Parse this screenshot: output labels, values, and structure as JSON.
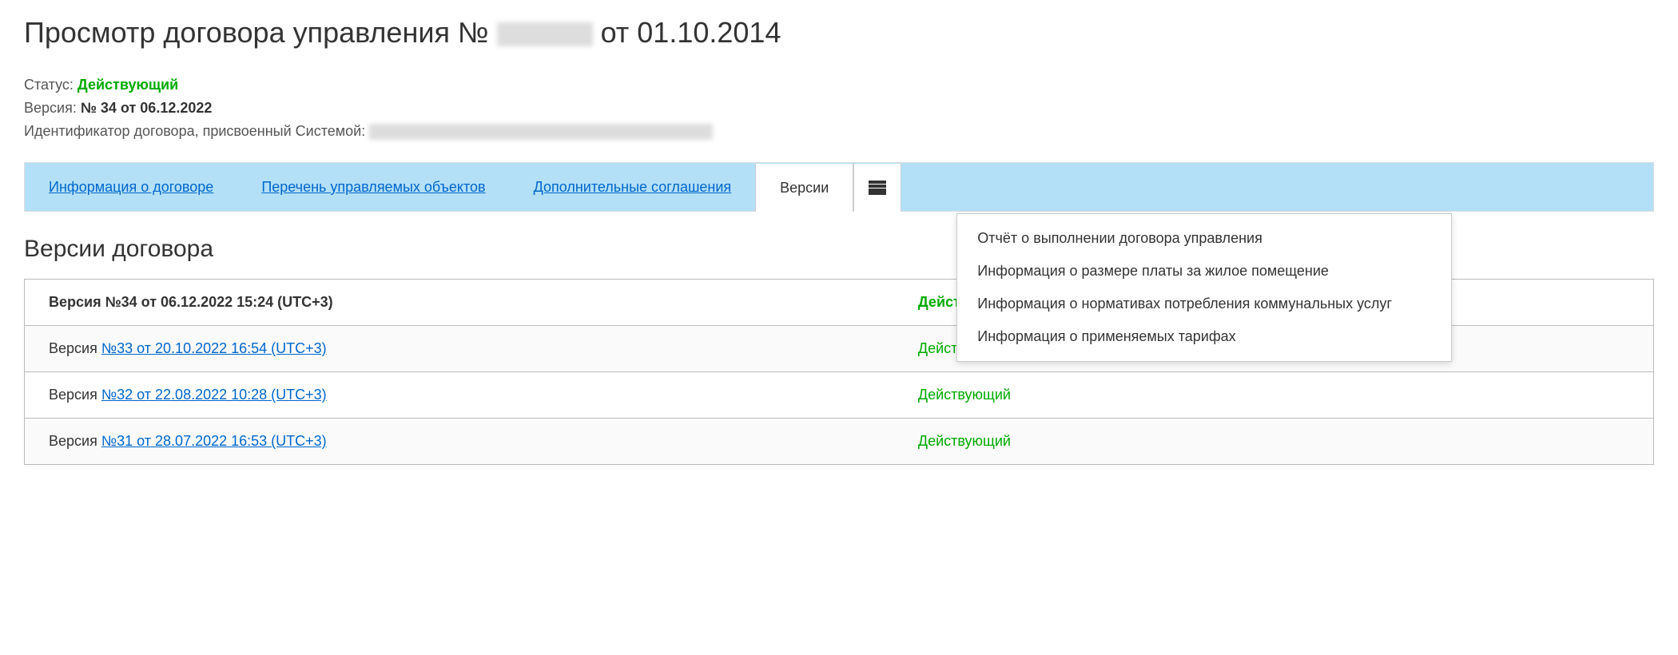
{
  "header": {
    "title_prefix": "Просмотр договора управления № ",
    "title_suffix": " от 01.10.2014"
  },
  "meta": {
    "status_label": "Статус: ",
    "status_value": "Действующий",
    "version_label": "Версия: ",
    "version_value": "№ 34 от 06.12.2022",
    "id_label": "Идентификатор договора, присвоенный Системой: "
  },
  "tabs": {
    "info": "Информация о договоре",
    "objects": "Перечень управляемых объектов",
    "agreements": "Дополнительные соглашения",
    "versions": "Версии"
  },
  "dropdown": [
    "Отчёт о выполнении договора управления",
    "Информация о размере платы за жилое помещение",
    "Информация о нормативах потребления коммунальных услуг",
    "Информация о применяемых тарифах"
  ],
  "section": {
    "title": "Версии договора"
  },
  "versions": [
    {
      "prefix": "Версия №34 от 06.12.2022 15:24 (UTC+3)",
      "link": "",
      "status": "Действующий",
      "current": true
    },
    {
      "prefix": "Версия ",
      "link": "№33 от 20.10.2022 16:54 (UTC+3)",
      "status": "Действующий",
      "current": false
    },
    {
      "prefix": "Версия ",
      "link": "№32 от 22.08.2022 10:28 (UTC+3)",
      "status": "Действующий",
      "current": false
    },
    {
      "prefix": "Версия ",
      "link": "№31 от 28.07.2022 16:53 (UTC+3)",
      "status": "Действующий",
      "current": false
    }
  ]
}
